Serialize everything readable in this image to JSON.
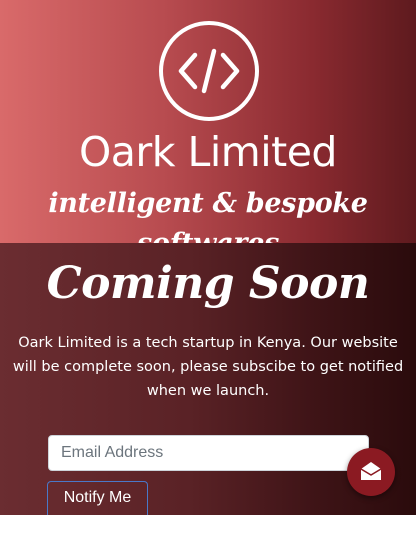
{
  "header": {
    "logo_icon": "code-icon",
    "brand": "Oark Limited",
    "tagline": "intelligent & bespoke softwares"
  },
  "main": {
    "heading": "Coming Soon",
    "description": "Oark Limited is a tech startup in Kenya. Our website will be complete soon, please subscibe to get notified when we launch.",
    "email_placeholder": "Email Address",
    "email_value": "",
    "notify_label": "Notify Me"
  },
  "fab": {
    "icon": "envelope-open-icon"
  },
  "colors": {
    "hero_gradient": [
      "#d96a6a",
      "#5e1a1e"
    ],
    "content_gradient": [
      "#6b2d31",
      "#2a0b0c"
    ],
    "fab": "#8b1a22",
    "button_border": "#4a78c8"
  }
}
